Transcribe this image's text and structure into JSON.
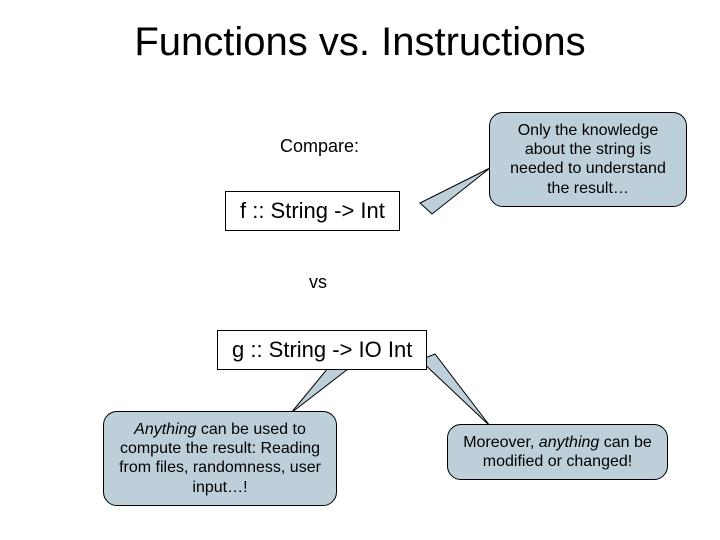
{
  "title": "Functions vs. Instructions",
  "compare_label": "Compare:",
  "code_f": "f :: String -> Int",
  "vs_label": "vs",
  "code_g": "g :: String -> IO Int",
  "callout_top_prefix": "Only the knowledge about the string is needed to understand the result…",
  "callout_left_prefix": "Anything",
  "callout_left_rest": " can be used to compute the result: Reading from files, randomness, user input…!",
  "callout_right_prefix": "Moreover, ",
  "callout_right_em": "anything",
  "callout_right_rest": " can be modified or changed!"
}
